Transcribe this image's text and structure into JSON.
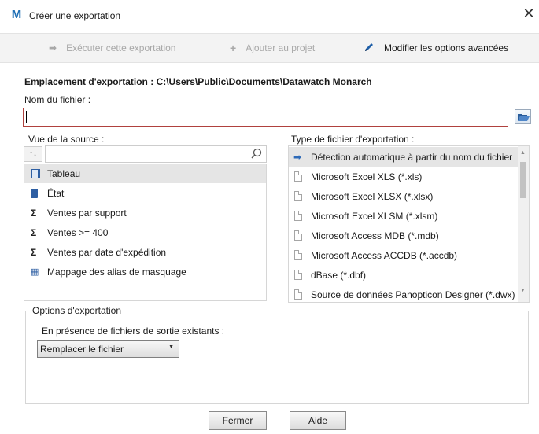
{
  "window": {
    "title": "Créer une exportation",
    "app_icon_glyph": "M",
    "close_glyph": "✕"
  },
  "toolbar": {
    "run_label": "Exécuter cette exportation",
    "add_label": "Ajouter au projet",
    "advanced_label": "Modifier les options avancées"
  },
  "location": {
    "label": "Emplacement d'exportation :",
    "path": "C:\\Users\\Public\\Documents\\Datawatch Monarch"
  },
  "filename": {
    "label": "Nom du fichier :",
    "value": ""
  },
  "source": {
    "label": "Vue de la source :",
    "search_value": "",
    "sort_glyph": "↑↓",
    "items": [
      {
        "label": "Tableau",
        "icon": "table-icon",
        "selected": true
      },
      {
        "label": "État",
        "icon": "report-icon",
        "selected": false
      },
      {
        "label": "Ventes par support",
        "icon": "summary-icon",
        "selected": false
      },
      {
        "label": "Ventes >= 400",
        "icon": "summary-icon",
        "selected": false
      },
      {
        "label": "Ventes par date d'expédition",
        "icon": "summary-icon",
        "selected": false
      },
      {
        "label": "Mappage des alias de masquage",
        "icon": "mask-alias-icon",
        "selected": false
      }
    ]
  },
  "file_type": {
    "label": "Type de fichier d'exportation :",
    "items": [
      {
        "label": "Détection automatique à partir du nom du fichier",
        "selected": true
      },
      {
        "label": "Microsoft Excel XLS (*.xls)",
        "selected": false
      },
      {
        "label": "Microsoft Excel XLSX (*.xlsx)",
        "selected": false
      },
      {
        "label": "Microsoft Excel XLSM (*.xlsm)",
        "selected": false
      },
      {
        "label": "Microsoft Access MDB (*.mdb)",
        "selected": false
      },
      {
        "label": "Microsoft Access ACCDB (*.accdb)",
        "selected": false
      },
      {
        "label": "dBase (*.dbf)",
        "selected": false
      },
      {
        "label": "Source de données Panopticon Designer (*.dwx)",
        "selected": false
      }
    ]
  },
  "options": {
    "legend": "Options d'exportation",
    "existing_label": "En présence de fichiers de sortie existants :",
    "existing_value": "Remplacer le fichier"
  },
  "footer": {
    "close_label": "Fermer",
    "help_label": "Aide"
  }
}
